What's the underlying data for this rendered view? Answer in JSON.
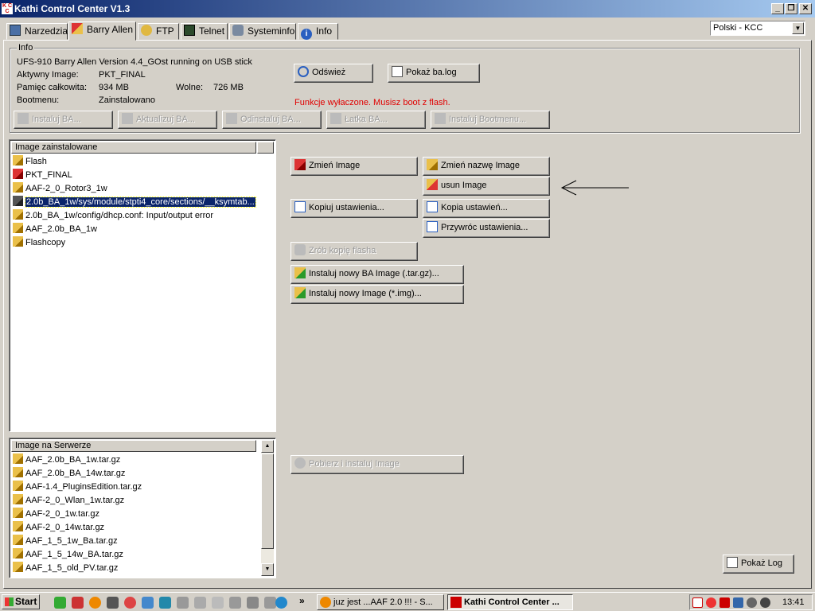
{
  "window": {
    "title": "Kathi Control Center V1.3",
    "icon_text": "K C C",
    "minimize": "_",
    "restore": "❐",
    "close": "✕"
  },
  "tabs": [
    {
      "label": "Narzedzia",
      "icon": "clipboard-icon"
    },
    {
      "label": "Barry Allen",
      "icon": "pencil-icon",
      "active": true
    },
    {
      "label": "FTP",
      "icon": "ftp-icon"
    },
    {
      "label": "Telnet",
      "icon": "monitor-icon"
    },
    {
      "label": "Systeminfo",
      "icon": "hardware-icon"
    },
    {
      "label": "Info",
      "icon": "info-icon"
    }
  ],
  "language": {
    "value": "Polski - KCC"
  },
  "info": {
    "legend": "Info",
    "line1": "UFS-910 Barry Allen Version 4.4_GOst running on USB stick",
    "active_image_label": "Aktywny Image:",
    "active_image_value": "PKT_FINAL",
    "memory_label": "Pamięc całkowita:",
    "memory_value": "934 MB",
    "free_label": "Wolne:",
    "free_value": "726 MB",
    "bootmenu_label": "Bootmenu:",
    "bootmenu_value": "Zainstalowano",
    "refresh_button": "Odśwież",
    "showlog_button": "Pokaż ba.log",
    "warning": "Funkcje wyłaczone. Musisz boot z flash.",
    "buttons": [
      "Instaluj BA...",
      "Aktualizuj BA...",
      "Odinstaluj BA...",
      "Łatka BA...",
      "Instaluj Bootmenu..."
    ]
  },
  "installed": {
    "header": "Image zainstalowane",
    "items": [
      "Flash",
      "PKT_FINAL",
      "AAF-2_0_Rotor3_1w",
      "2.0b_BA_1w/sys/module/stpti4_core/sections/__ksymtab...",
      "2.0b_BA_1w/config/dhcp.conf: Input/output error",
      "AAF_2.0b_BA_1w",
      "Flashcopy"
    ],
    "selected_index": 3
  },
  "server": {
    "header": "Image na Serwerze",
    "items": [
      "AAF_2.0b_BA_1w.tar.gz",
      "AAF_2.0b_BA_14w.tar.gz",
      "AAF-1.4_PluginsEdition.tar.gz",
      "AAF-2_0_Wlan_1w.tar.gz",
      "AAF-2_0_1w.tar.gz",
      "AAF-2_0_14w.tar.gz",
      "AAF_1_5_1w_Ba.tar.gz",
      "AAF_1_5_14w_BA.tar.gz",
      "AAF_1_5_old_PV.tar.gz"
    ]
  },
  "actions": {
    "change_image": "Zmień Image",
    "rename_image": "Zmień nazwę Image",
    "delete_image": "usun Image",
    "copy_settings": "Kopiuj ustawienia...",
    "settings_copy": "Kopia ustawień...",
    "restore_settings": "Przywróc ustawienia...",
    "flash_backup": "Zrób kopię flasha",
    "install_ba_image": "Instaluj nowy BA Image (.tar.gz)...",
    "install_image": "Instaluj nowy Image (*.img)...",
    "download_install": "Pobierz i instaluj Image",
    "show_log": "Pokaż Log"
  },
  "taskbar": {
    "start": "Start",
    "overflow": "»",
    "task1": "juz jest ...AAF 2.0 !!! - S...",
    "task2": "Kathi Control Center ...",
    "clock": "13:41"
  },
  "colors": {
    "accent": "#0a246a",
    "warning": "#e00000",
    "face": "#d4d0c8"
  }
}
